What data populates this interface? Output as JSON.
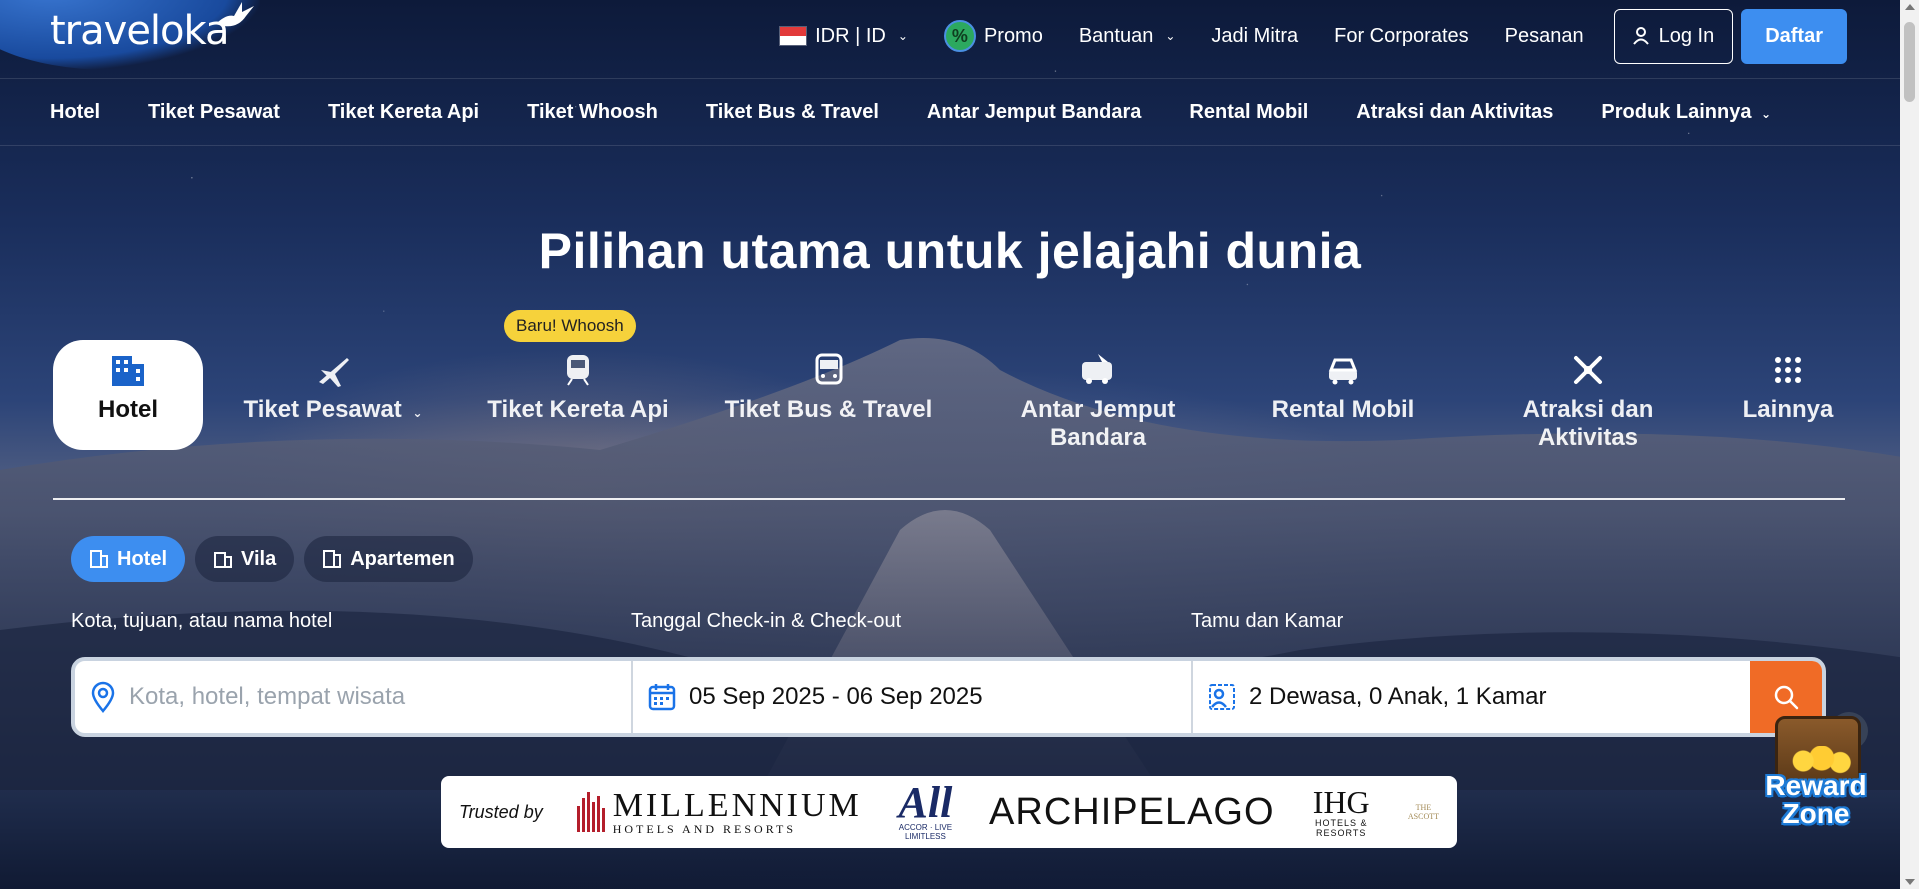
{
  "brand": {
    "logo_text": "traveloka"
  },
  "topnav": {
    "currency": "IDR | ID",
    "promo": "Promo",
    "bantuan": "Bantuan",
    "mitra": "Jadi Mitra",
    "corporates": "For Corporates",
    "pesanan": "Pesanan",
    "login": "Log In",
    "signup": "Daftar"
  },
  "catnav": [
    "Hotel",
    "Tiket Pesawat",
    "Tiket Kereta Api",
    "Tiket Whoosh",
    "Tiket Bus & Travel",
    "Antar Jemput Bandara",
    "Rental Mobil",
    "Atraksi dan Aktivitas",
    "Produk Lainnya"
  ],
  "headline": "Pilihan utama untuk jelajahi dunia",
  "product_badge": "Baru! Whoosh",
  "products": [
    {
      "label": "Hotel",
      "icon": "building-icon",
      "active": true
    },
    {
      "label": "Tiket Pesawat",
      "icon": "plane-icon"
    },
    {
      "label": "Tiket Kereta Api",
      "icon": "train-icon"
    },
    {
      "label": "Tiket Bus & Travel",
      "icon": "bus-icon"
    },
    {
      "label": "Antar Jemput Bandara",
      "icon": "airport-shuttle-icon"
    },
    {
      "label": "Rental Mobil",
      "icon": "car-icon"
    },
    {
      "label": "Atraksi dan Aktivitas",
      "icon": "attraction-icon"
    },
    {
      "label": "Lainnya",
      "icon": "grid-icon"
    }
  ],
  "property_tabs": [
    "Hotel",
    "Vila",
    "Apartemen"
  ],
  "fields": {
    "destination_label": "Kota, tujuan, atau nama hotel",
    "dates_label": "Tanggal Check-in & Check-out",
    "guests_label": "Tamu dan Kamar",
    "destination_placeholder": "Kota, hotel, tempat wisata",
    "dates_value": "05 Sep 2025 - 06 Sep 2025",
    "guests_value": "2 Dewasa, 0 Anak, 1 Kamar"
  },
  "trusted": {
    "label": "Trusted by",
    "millennium": "MILLENNIUM",
    "millennium_sub": "HOTELS AND RESORTS",
    "all": "All",
    "all_sub": "ACCOR · LIVE LIMITLESS",
    "archipelago": "ARCHIPELAGO",
    "ihg": "IHG",
    "ihg_sub": "HOTELS & RESORTS",
    "ascott": "THE ASCOTT"
  },
  "reward": {
    "label_1": "Reward",
    "label_2": "Zone"
  },
  "colors": {
    "accent": "#3d8ef0",
    "search_button": "#f06b26",
    "badge": "#f6d23b"
  }
}
